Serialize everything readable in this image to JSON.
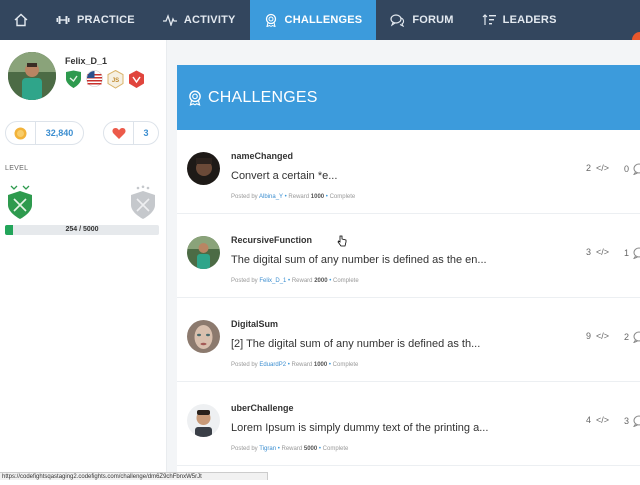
{
  "nav": {
    "items": [
      {
        "label": "PRACTICE",
        "icon": "dumbbell-icon"
      },
      {
        "label": "ACTIVITY",
        "icon": "activity-icon"
      },
      {
        "label": "CHALLENGES",
        "icon": "award-icon",
        "active": true
      },
      {
        "label": "FORUM",
        "icon": "chat-icon"
      },
      {
        "label": "LEADERS",
        "icon": "leaders-icon"
      }
    ]
  },
  "profile": {
    "username": "Felix_D_1",
    "coins": "32,840",
    "hearts": "3",
    "level_label": "LEVEL",
    "progress_text": "254 / 5000",
    "progress_fraction": 0.0508
  },
  "panel": {
    "title": "CHALLENGES"
  },
  "challenges": [
    {
      "title": "nameChanged",
      "description": "Convert a certain *e...",
      "posted_by": "Posted by",
      "author": "Albina_Y",
      "reward_label": "Reward",
      "reward": "1000",
      "status": "Complete",
      "languages": "2",
      "comments": "0"
    },
    {
      "title": "RecursiveFunction",
      "description": "The digital sum of any number is defined as the en...",
      "posted_by": "Posted by",
      "author": "Felix_D_1",
      "reward_label": "Reward",
      "reward": "2000",
      "status": "Complete",
      "languages": "3",
      "comments": "1"
    },
    {
      "title": "DigitalSum",
      "description": "[2] The digital sum of any number is defined as th...",
      "posted_by": "Posted by",
      "author": "EduardP2",
      "reward_label": "Reward",
      "reward": "1000",
      "status": "Complete",
      "languages": "9",
      "comments": "2"
    },
    {
      "title": "uberChallenge",
      "description": "Lorem Ipsum is simply dummy text of the printing a...",
      "posted_by": "Posted by",
      "author": "Tigran",
      "reward_label": "Reward",
      "reward": "5000",
      "status": "Complete",
      "languages": "4",
      "comments": "3"
    }
  ],
  "code_symbol": "</>",
  "status_bar": "https://codefightsqastaging2.codefights.com/challenge/dm6Z9chFbnxW5rJt",
  "colors": {
    "nav_bg": "#33465e",
    "accent": "#3c9bdc",
    "progress": "#23a55a",
    "link": "#3c8ed0"
  }
}
